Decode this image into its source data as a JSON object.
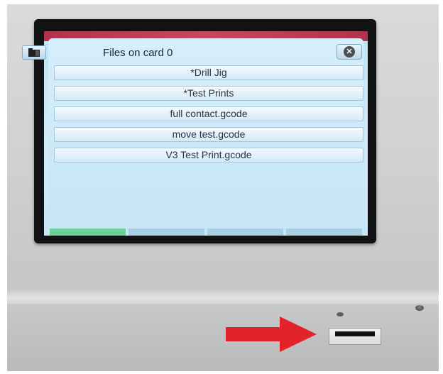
{
  "dialog": {
    "title": "Files on card 0",
    "icons": {
      "folder": "folder-icon",
      "close": "close-circle-icon"
    }
  },
  "files": [
    "*Drill Jig",
    "*Test Prints",
    "full contact.gcode",
    "move test.gcode",
    "V3 Test Print.gcode"
  ],
  "colors": {
    "screen_bg": "#c6e5f6",
    "active_tab": "#6ed09a",
    "title_bar": "#b4324c",
    "arrow": "#e2232a"
  },
  "hardware": {
    "pointer": "red-arrow",
    "slot": "sd-card-slot"
  }
}
